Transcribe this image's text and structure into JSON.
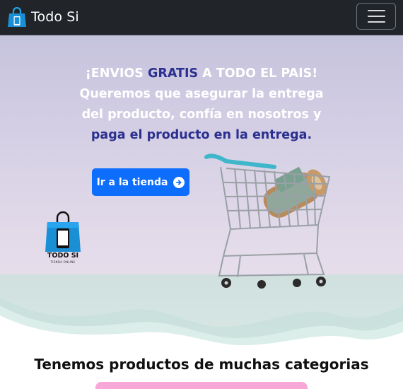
{
  "navbar": {
    "brand_text": "Todo Si",
    "brand_icon": "shopping-bag-icon",
    "toggler_icon": "hamburger-menu-icon"
  },
  "hero": {
    "line1_part1": "¡ENVIOS ",
    "line1_highlight": "GRATIS",
    "line1_part2": " A TODO EL PAIS!",
    "line2": "Queremos que asegurar la entrega",
    "line3": "del producto, confía en nosotros y",
    "line4": "paga el producto en la entrega.",
    "cta_label": "Ir a la tienda",
    "cta_icon": "arrow-circle-right-icon",
    "logo_title": "TODO SI",
    "logo_subtitle": "TIENDA ONLINE"
  },
  "section": {
    "title": "Tenemos productos de muchas categorias"
  },
  "colors": {
    "navbar_bg": "#212529",
    "accent_blue": "#0d6efd",
    "highlight_text": "#2b2f8f",
    "pink": "#f7a8d8"
  }
}
